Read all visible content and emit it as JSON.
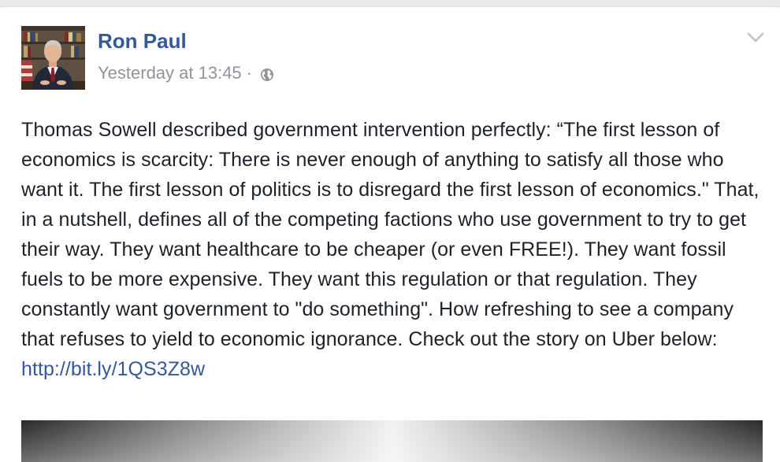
{
  "post": {
    "author": "Ron Paul",
    "timestamp": "Yesterday at 13:45",
    "separator": "·",
    "privacy_icon": "globe-icon",
    "menu_icon": "chevron-down-icon",
    "body": "Thomas Sowell described government intervention perfectly: “The first lesson of economics is scarcity: There is never enough of anything to satisfy all those who want it. The first lesson of politics is to disregard the first lesson of economics.\" That, in a nutshell, defines all of the competing factions who use government to try to get their way. They want healthcare to be cheaper (or even FREE!). They want fossil fuels to be more expensive. They want this regulation or that regulation. They constantly want government to \"do something\". How refreshing to see a company that refuses to yield to economic ignorance. Check out the story on Uber below:",
    "link": "http://bit.ly/1QS3Z8w"
  },
  "colors": {
    "page_background": "#e9ebee",
    "card_background": "#ffffff",
    "name_blue": "#365899",
    "meta_gray": "#90949c",
    "body_text": "#1d2129"
  }
}
